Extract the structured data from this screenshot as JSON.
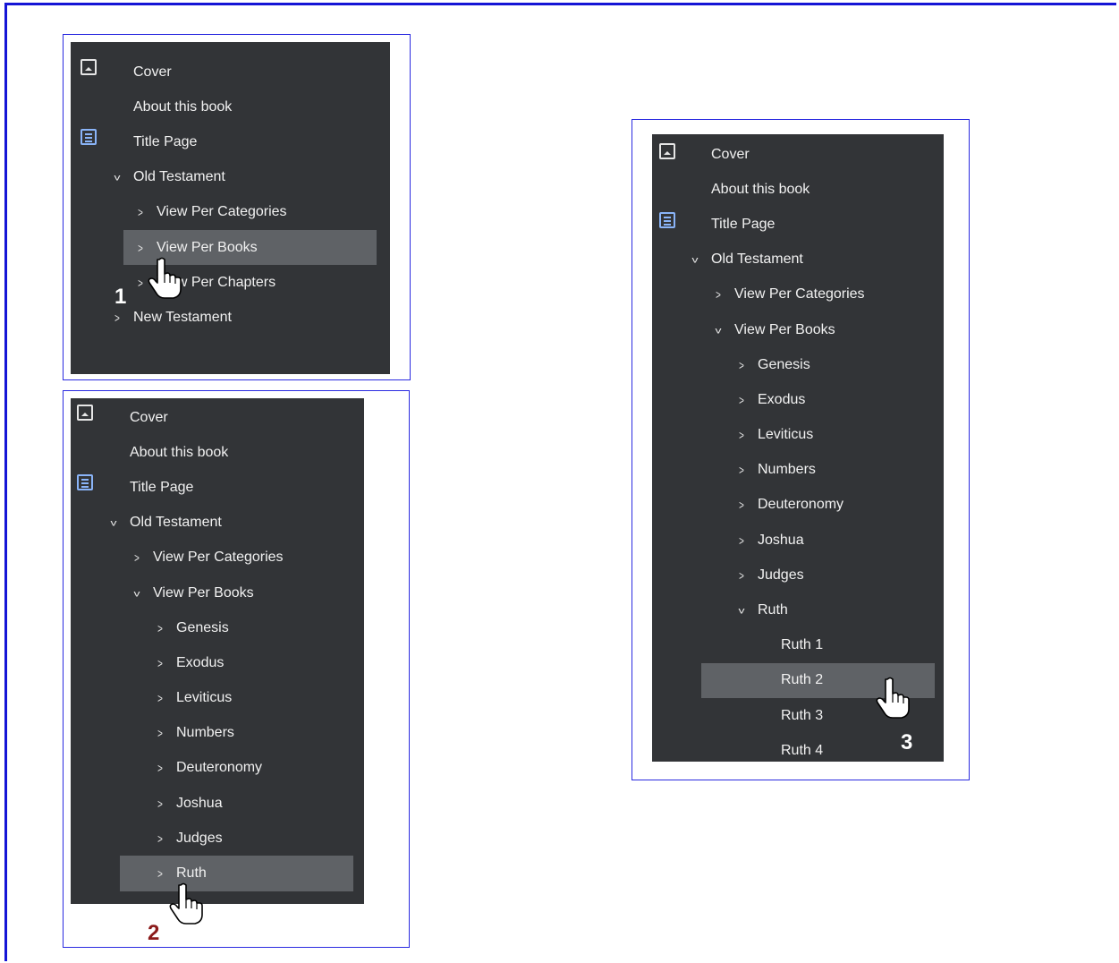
{
  "colors": {
    "frame": "#2a2ae0",
    "panel_bg": "#323437",
    "highlight": "#5f6266",
    "toc_icon": "#8ab4f8",
    "step_white": "#ffffff",
    "step_red": "#8b1a1a"
  },
  "icons": [
    "image-icon",
    "table-of-contents-icon",
    "chevron-right-icon",
    "chevron-down-icon",
    "hand-cursor-icon"
  ],
  "panel1": {
    "step": "1",
    "items": [
      {
        "label": "Cover"
      },
      {
        "label": "About this book"
      },
      {
        "label": "Title Page"
      },
      {
        "label": "Old Testament",
        "chevron": "down"
      },
      {
        "label": "View Per Categories",
        "chevron": "right"
      },
      {
        "label": "View Per Books",
        "chevron": "right",
        "highlight": true
      },
      {
        "label": "View Per Chapters",
        "chevron": "right"
      },
      {
        "label": "New Testament",
        "chevron": "right"
      }
    ]
  },
  "panel2": {
    "step": "2",
    "items": [
      {
        "label": "Cover"
      },
      {
        "label": "About this book"
      },
      {
        "label": "Title Page"
      },
      {
        "label": "Old Testament",
        "chevron": "down"
      },
      {
        "label": "View Per Categories",
        "chevron": "right"
      },
      {
        "label": "View Per Books",
        "chevron": "down"
      },
      {
        "label": "Genesis",
        "chevron": "right"
      },
      {
        "label": "Exodus",
        "chevron": "right"
      },
      {
        "label": "Leviticus",
        "chevron": "right"
      },
      {
        "label": "Numbers",
        "chevron": "right"
      },
      {
        "label": "Deuteronomy",
        "chevron": "right"
      },
      {
        "label": "Joshua",
        "chevron": "right"
      },
      {
        "label": "Judges",
        "chevron": "right"
      },
      {
        "label": "Ruth",
        "chevron": "right",
        "highlight": true
      }
    ]
  },
  "panel3": {
    "step": "3",
    "items": [
      {
        "label": "Cover"
      },
      {
        "label": "About this book"
      },
      {
        "label": "Title Page"
      },
      {
        "label": "Old Testament",
        "chevron": "down"
      },
      {
        "label": "View Per Categories",
        "chevron": "right"
      },
      {
        "label": "View Per Books",
        "chevron": "down"
      },
      {
        "label": "Genesis",
        "chevron": "right"
      },
      {
        "label": "Exodus",
        "chevron": "right"
      },
      {
        "label": "Leviticus",
        "chevron": "right"
      },
      {
        "label": "Numbers",
        "chevron": "right"
      },
      {
        "label": "Deuteronomy",
        "chevron": "right"
      },
      {
        "label": "Joshua",
        "chevron": "right"
      },
      {
        "label": "Judges",
        "chevron": "right"
      },
      {
        "label": "Ruth",
        "chevron": "down"
      },
      {
        "label": "Ruth 1"
      },
      {
        "label": "Ruth 2",
        "highlight": true
      },
      {
        "label": "Ruth 3"
      },
      {
        "label": "Ruth 4"
      }
    ]
  }
}
